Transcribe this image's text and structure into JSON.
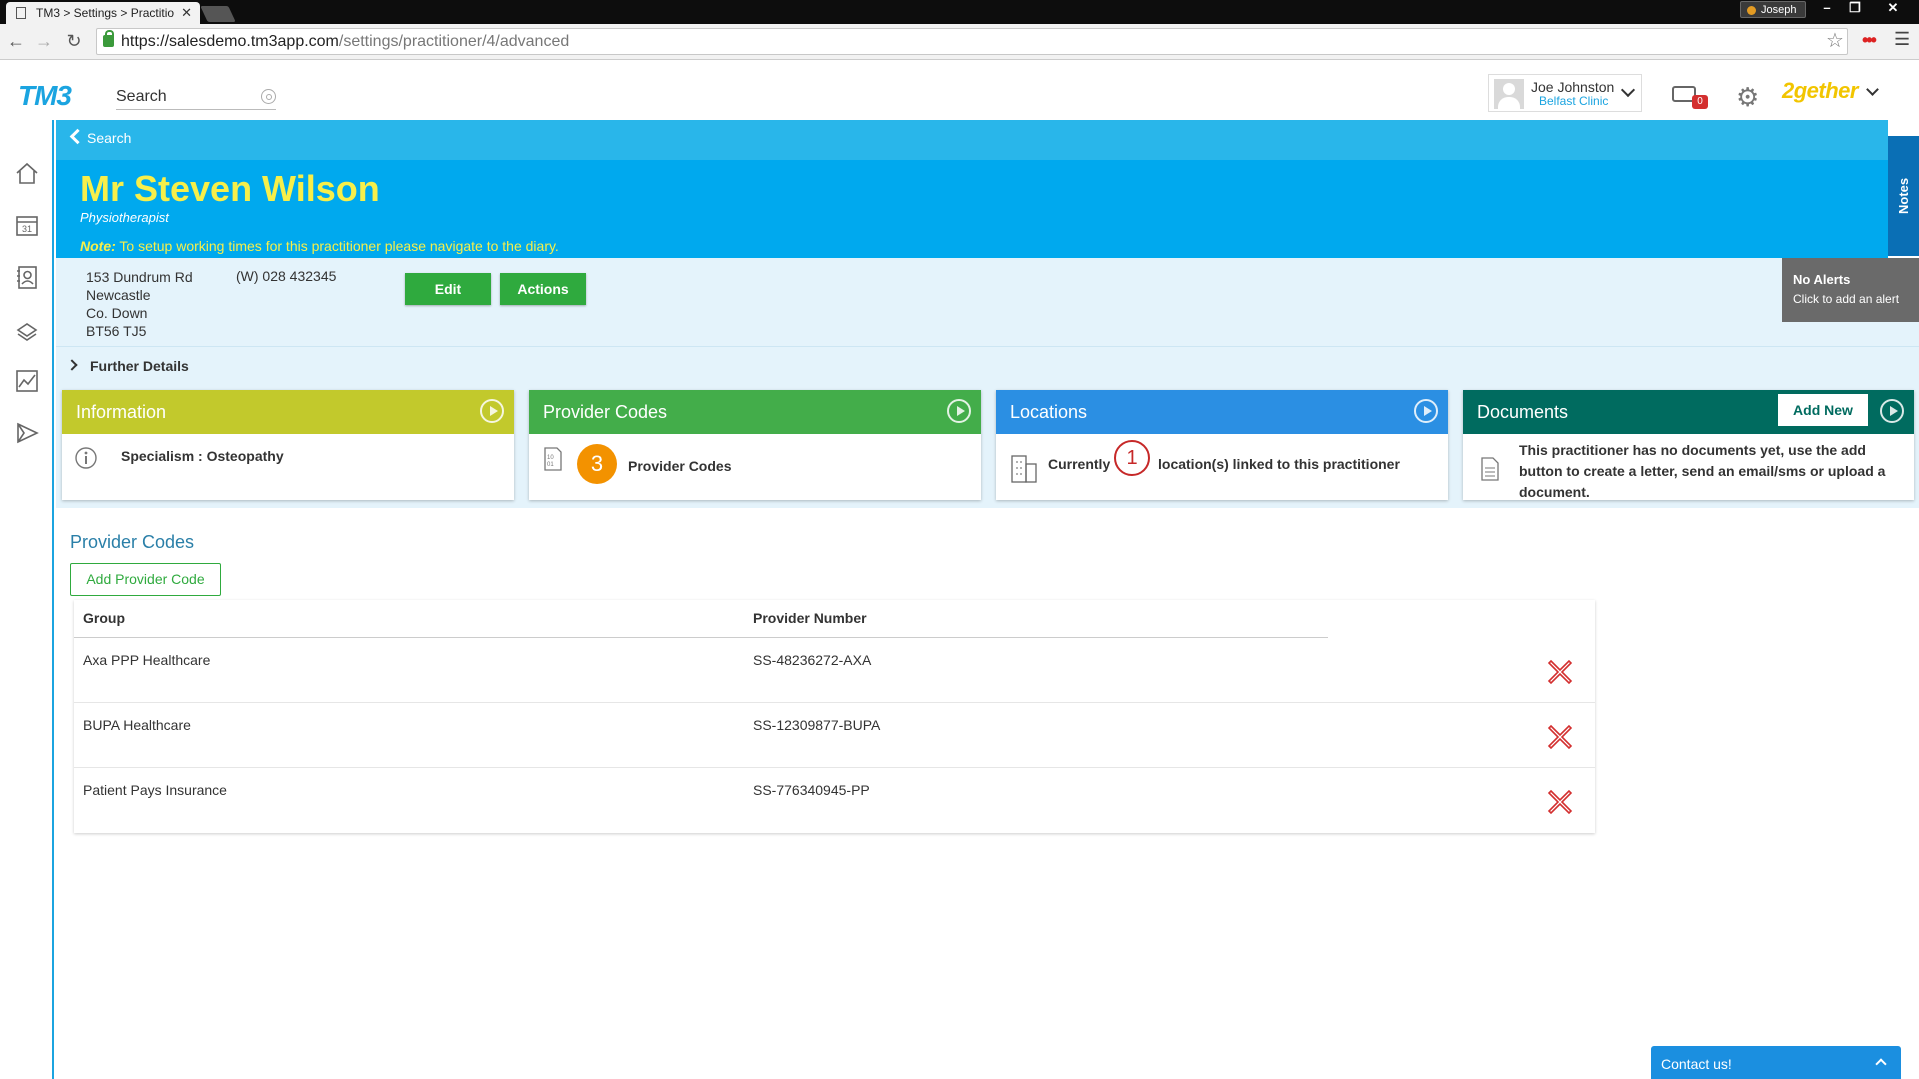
{
  "browser": {
    "tab_title": "TM3 > Settings > Practitio",
    "tab_close": "✕",
    "window_user": "Joseph",
    "url_host": "https://salesdemo.tm3app.com",
    "url_path": "/settings/practitioner/4/advanced"
  },
  "header": {
    "logo": "TM3",
    "search_placeholder": "Search",
    "user_name": "Joe Johnston",
    "user_clinic": "Belfast Clinic",
    "inbox_count": "0",
    "brand": "2gether",
    "icons": [
      "home-icon",
      "calendar-icon",
      "contacts-icon",
      "inbox-icon",
      "chart-icon",
      "send-icon"
    ]
  },
  "banner": {
    "back_label": "Search",
    "name": "Mr Steven Wilson",
    "role": "Physiotherapist",
    "note_label": "Note:",
    "note_text": " To setup working times for this practitioner please navigate to the diary.",
    "notes_tab": "Notes"
  },
  "contact_info": {
    "address": [
      "153 Dundrum Rd",
      "Newcastle",
      "Co. Down",
      "BT56 TJ5"
    ],
    "phone": "(W)  028 432345",
    "edit_label": "Edit",
    "actions_label": "Actions",
    "alerts_title": "No Alerts",
    "alerts_sub": "Click to add an alert",
    "further_details": "Further Details"
  },
  "cards": {
    "information": {
      "title": "Information",
      "text": "Specialism : Osteopathy",
      "color": "#c2c92c"
    },
    "provider_codes": {
      "title": "Provider Codes",
      "count": "3",
      "text": "Provider Codes",
      "color": "#43ad4a"
    },
    "locations": {
      "title": "Locations",
      "prefix": "Currently",
      "count": "1",
      "suffix": "location(s) linked to this practitioner",
      "color": "#2b8fe3"
    },
    "documents": {
      "title": "Documents",
      "add_label": "Add New",
      "text": "This practitioner has no documents yet, use the add button to create a letter, send an email/sms or upload a document.",
      "color": "#006b5f"
    }
  },
  "provider_section": {
    "title": "Provider Codes",
    "add_label": "Add Provider Code",
    "columns": [
      "Group",
      "Provider Number"
    ],
    "rows": [
      {
        "group": "Axa PPP Healthcare",
        "number": "SS-48236272-AXA"
      },
      {
        "group": "BUPA Healthcare",
        "number": "SS-12309877-BUPA"
      },
      {
        "group": "Patient Pays Insurance",
        "number": "SS-776340945-PP"
      }
    ]
  },
  "contact": {
    "label": "Contact us!"
  }
}
